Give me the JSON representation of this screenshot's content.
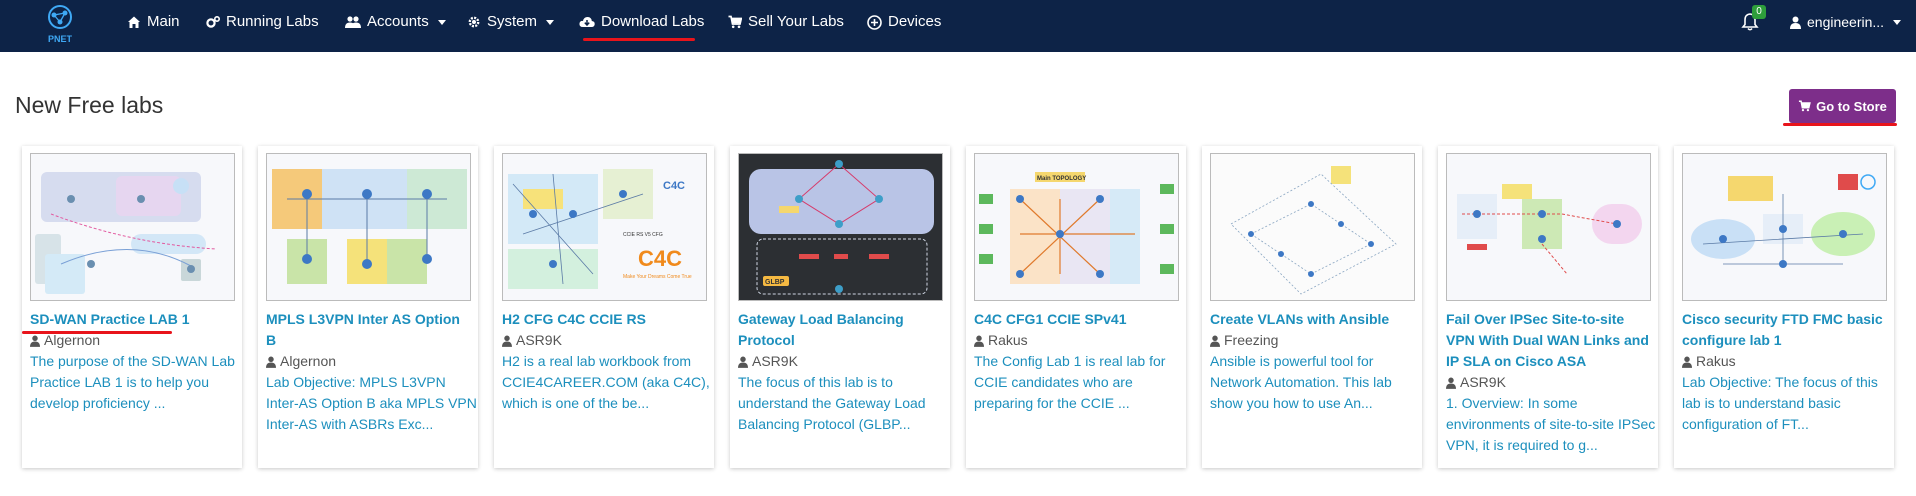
{
  "nav": {
    "logo_text": "PNET",
    "items": [
      {
        "label": "Main",
        "icon": "home-icon"
      },
      {
        "label": "Running Labs",
        "icon": "cogs-icon"
      },
      {
        "label": "Accounts",
        "icon": "users-icon"
      },
      {
        "label": "System",
        "icon": "gear-icon"
      },
      {
        "label": "Download Labs",
        "icon": "cloud-download-icon"
      },
      {
        "label": "Sell Your Labs",
        "icon": "cart-icon"
      },
      {
        "label": "Devices",
        "icon": "plus-circle-icon"
      }
    ],
    "notification_count": "0",
    "user_label": "engineerin..."
  },
  "page": {
    "title": "New Free labs",
    "store_button": "Go to Store"
  },
  "cards": [
    {
      "title": "SD-WAN Practice LAB 1",
      "author": "Algernon",
      "description": "The purpose of the SD-WAN Lab Practice LAB 1 is to help you develop proficiency ..."
    },
    {
      "title": "MPLS L3VPN Inter AS Option B",
      "author": "Algernon",
      "description": "Lab Objective: MPLS L3VPN Inter-AS Option B aka MPLS VPN Inter-AS with ASBRs Exc..."
    },
    {
      "title": "H2 CFG C4C CCIE RS",
      "author": "ASR9K",
      "description": "H2 is a real lab workbook from CCIE4CAREER.COM (aka C4C), which is one of the be..."
    },
    {
      "title": "Gateway Load Balancing Protocol",
      "author": "ASR9K",
      "description": "The focus of this lab is to understand the Gateway Load Balancing Protocol (GLBP..."
    },
    {
      "title": "C4C CFG1 CCIE SPv41",
      "author": "Rakus",
      "description": "The Config Lab 1 is real lab for CCIE candidates who are preparing for the CCIE ..."
    },
    {
      "title": "Create VLANs with Ansible",
      "author": "Freezing",
      "description": "Ansible is powerful tool for Network Automation. This lab show you how to use An..."
    },
    {
      "title": "Fail Over IPSec Site-to-site VPN With Dual WAN Links and IP SLA on Cisco ASA",
      "author": "ASR9K",
      "description": "1. Overview: In some environments of site-to-site IPSec VPN, it is required to g..."
    },
    {
      "title": "Cisco security FTD FMC basic configure lab 1",
      "author": "Rakus",
      "description": "Lab Objective: The focus of this lab is to understand basic configuration of FT..."
    }
  ],
  "thumb_labels": {
    "c4c_brand": "C4C",
    "c4c_tagline": "Make Your Dreams Come True",
    "c4c_cfg": "CCIE RS V5 CFG",
    "glbp_label": "GLBP",
    "main_topology": "Main TOPOLOGY"
  },
  "colors": {
    "navbar": "#0d2347",
    "link": "#1c8fbd",
    "store": "#7d2e8a",
    "underline": "#e8141b",
    "badge": "#2e9e3b"
  }
}
